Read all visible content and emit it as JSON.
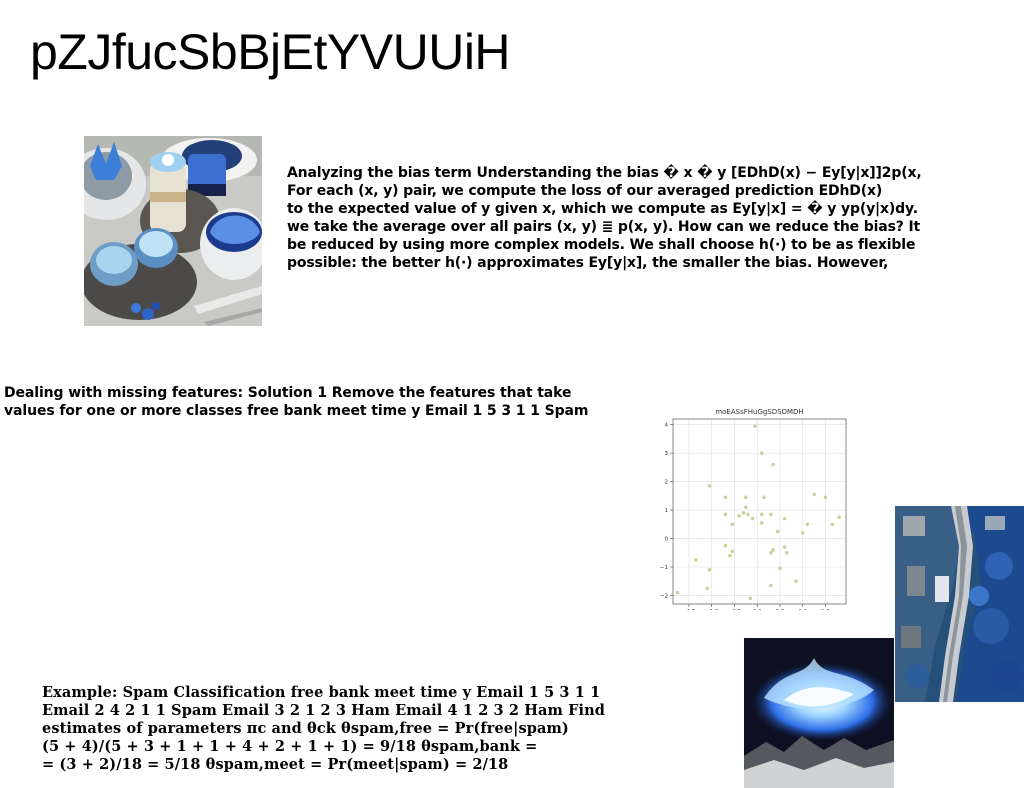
{
  "page": {
    "title": "pZJfucSbBjEtYVUUiH"
  },
  "bias_paragraph": {
    "lines": [
      "Analyzing the bias term Understanding the bias � x � y [EDhD(x) − Ey[y|x]]2p(x,",
      "For each (x, y) pair, we compute the loss of our averaged prediction EDhD(x)",
      "to the expected value of y given x, which we compute as Ey[y|x] = � y yp(y|x)dy.",
      "we take the average over all pairs (x, y) ≣ p(x, y). How can we reduce the bias? It",
      "be reduced by using more complex models. We shall choose h(·) to be as flexible",
      "possible: the better h(·) approximates Ey[y|x], the smaller the bias. However,"
    ]
  },
  "missing_paragraph": {
    "lines": [
      "Dealing with missing features: Solution 1 Remove the features that take",
      "values for one or more classes free bank meet time y Email 1 5 3 1 1 Spam"
    ]
  },
  "spam_paragraph": {
    "lines": [
      "Example: Spam Classification free bank meet time y Email 1 5 3 1 1",
      "Email 2 4 2 1 1 Spam Email 3 2 1 2 3 Ham Email 4 1 2 3 2 Ham Find",
      "estimates of parameters πc and θck θspam,free = Pr(free|spam)",
      "(5 + 4)/(5 + 3 + 1 + 1 + 4 + 2 + 1 + 1) = 9/18 θspam,bank =",
      "= (3 + 2)/18 = 5/18 θspam,meet = Pr(meet|spam) = 2/18"
    ]
  },
  "images": [
    {
      "name": "dessert-photo",
      "subject": "blue cupcakes, cakes and coffee cup on table"
    },
    {
      "name": "aerial-photo",
      "subject": "aerial view of road through blue forest"
    },
    {
      "name": "flame-photo",
      "subject": "blue glowing flame over dark mountains"
    }
  ],
  "chart_data": {
    "type": "scatter",
    "title": "moEASsFHuGgSDSDMDH",
    "xlabel": "",
    "ylabel": "",
    "xlim": [
      -1.85,
      1.95
    ],
    "ylim": [
      -2.3,
      4.2
    ],
    "xticks": [
      -1.5,
      -1.0,
      -0.5,
      0.0,
      0.5,
      1.0,
      1.5
    ],
    "xtick_labels": [
      "−1.5",
      "−1.0",
      "−0.5",
      "0.0",
      "0.5",
      "1.0",
      "1.5"
    ],
    "yticks": [
      -2,
      -1,
      0,
      1,
      2,
      3,
      4
    ],
    "ytick_labels": [
      "−2",
      "−1",
      "0",
      "1",
      "2",
      "3",
      "4"
    ],
    "grid": true,
    "point_color": "#c8d29a",
    "points": [
      [
        -0.05,
        3.95
      ],
      [
        0.1,
        3.0
      ],
      [
        0.35,
        2.6
      ],
      [
        -1.05,
        1.85
      ],
      [
        -0.7,
        1.45
      ],
      [
        -0.25,
        1.45
      ],
      [
        0.15,
        1.45
      ],
      [
        1.25,
        1.55
      ],
      [
        1.5,
        1.45
      ],
      [
        -0.7,
        0.85
      ],
      [
        -0.4,
        0.8
      ],
      [
        -0.3,
        0.9
      ],
      [
        -0.2,
        0.85
      ],
      [
        -0.1,
        0.7
      ],
      [
        0.1,
        0.85
      ],
      [
        0.3,
        0.85
      ],
      [
        -0.25,
        1.1
      ],
      [
        -0.55,
        0.5
      ],
      [
        0.1,
        0.55
      ],
      [
        0.6,
        0.7
      ],
      [
        1.1,
        0.5
      ],
      [
        1.8,
        0.75
      ],
      [
        1.65,
        0.5
      ],
      [
        0.45,
        0.25
      ],
      [
        1.0,
        0.2
      ],
      [
        -0.7,
        -0.25
      ],
      [
        -0.55,
        -0.45
      ],
      [
        -0.6,
        -0.6
      ],
      [
        0.3,
        -0.5
      ],
      [
        0.35,
        -0.4
      ],
      [
        0.6,
        -0.3
      ],
      [
        0.65,
        -0.5
      ],
      [
        -1.35,
        -0.75
      ],
      [
        -1.05,
        -1.1
      ],
      [
        0.5,
        -1.05
      ],
      [
        0.85,
        -1.5
      ],
      [
        0.3,
        -1.65
      ],
      [
        -1.1,
        -1.75
      ],
      [
        -1.75,
        -1.9
      ],
      [
        -0.15,
        -2.1
      ]
    ]
  }
}
